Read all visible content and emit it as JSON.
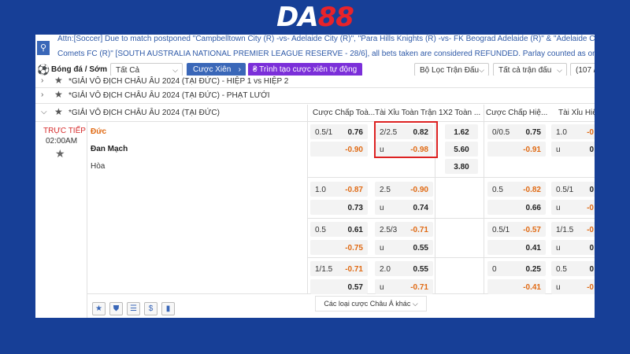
{
  "logo": {
    "part1": "DA",
    "part2": "88"
  },
  "ticker": {
    "line1": "Attn:[Soccer] Due to match postponed \"Campbelltown City (R) -vs- Adelaide City (R)\", \"Para Hills Knights (R) -vs- FK Beograd Adelaide (R)\" & \"Adelaide Cro",
    "line2": "Comets FC (R)\" [SOUTH AUSTRALIA NATIONAL PREMIER LEAGUE RESERVE - 28/6], all bets taken are considered REFUNDED. Parlay counted as one (1). Tha"
  },
  "toolbar": {
    "sport_label": "Bóng đá / Sớm",
    "filter_all": "Tất Cả",
    "parlay_button": "Cược Xiên",
    "builder_button": "₴ Trình tạo cược xiên tự động",
    "match_filter": "Bộ Lọc Trận Đấu",
    "all_matches": "Tất cả trận đấu",
    "count": "(107 /"
  },
  "leagues": [
    {
      "name": "*GIẢI VÔ ĐỊCH CHÂU ÂU 2024 (TẠI ĐỨC) - HIỆP 1 vs HIỆP 2"
    },
    {
      "name": "*GIẢI VÔ ĐỊCH CHÂU ÂU 2024 (TẠI ĐỨC) - PHẠT LƯỚI"
    },
    {
      "name": "*GIẢI VÔ ĐỊCH CHÂU ÂU 2024 (TẠI ĐỨC)"
    }
  ],
  "headers": {
    "ah_full": "Cược Chấp Toà...",
    "ou_full": "Tài Xỉu Toàn Trận",
    "x12_full": "1X2 Toàn ...",
    "ah_half": "Cược Chấp Hiệ...",
    "ou_half": "Tài Xỉu Hiệ"
  },
  "match": {
    "live": "TRỰC TIẾP",
    "time": "02:00AM",
    "home": "Đức",
    "away": "Đan Mạch",
    "draw": "Hòa"
  },
  "rows": [
    {
      "ah": {
        "line": "0.5/1",
        "home": "0.76",
        "away": "-0.90"
      },
      "ou": {
        "line": "2/2.5",
        "over": "0.82",
        "u": "u",
        "under": "-0.98"
      },
      "x12": [
        "1.62",
        "5.60",
        "3.80"
      ],
      "ah_h": {
        "line": "0/0.5",
        "home": "0.75",
        "away": "-0.91"
      },
      "ou_h": {
        "line": "1.0",
        "over": "-0",
        "u": "u",
        "under": "0"
      }
    },
    {
      "ah": {
        "line": "1.0",
        "home": "-0.87",
        "away": "0.73"
      },
      "ou": {
        "line": "2.5",
        "over": "-0.90",
        "u": "u",
        "under": "0.74"
      },
      "ah_h": {
        "line": "0.5",
        "home": "-0.82",
        "away": "0.66"
      },
      "ou_h": {
        "line": "0.5/1",
        "over": "0",
        "u": "u",
        "under": "-0"
      }
    },
    {
      "ah": {
        "line": "0.5",
        "home": "0.61",
        "away": "-0.75"
      },
      "ou": {
        "line": "2.5/3",
        "over": "-0.71",
        "u": "u",
        "under": "0.55"
      },
      "ah_h": {
        "line": "0.5/1",
        "home": "-0.57",
        "away": "0.41"
      },
      "ou_h": {
        "line": "1/1.5",
        "over": "-0",
        "u": "u",
        "under": "0"
      }
    },
    {
      "ah": {
        "line": "1/1.5",
        "home": "-0.71",
        "away": "0.57"
      },
      "ou": {
        "line": "2.0",
        "over": "0.55",
        "u": "u",
        "under": "-0.71"
      },
      "ah_h": {
        "line": "0",
        "home": "0.25",
        "away": "-0.41"
      },
      "ou_h": {
        "line": "0.5",
        "over": "0",
        "u": "u",
        "under": "-0"
      }
    }
  ],
  "footer": {
    "more_bets": "Các loại cược Châu Á khác ⌵"
  },
  "colors": {
    "background": "#173f97",
    "accent_blue": "#3a67b8",
    "builder_purple": "#7b2fd9",
    "negative_odds": "#e06a14",
    "live_red": "#d62b2b",
    "highlight_box": "#dd2222"
  }
}
